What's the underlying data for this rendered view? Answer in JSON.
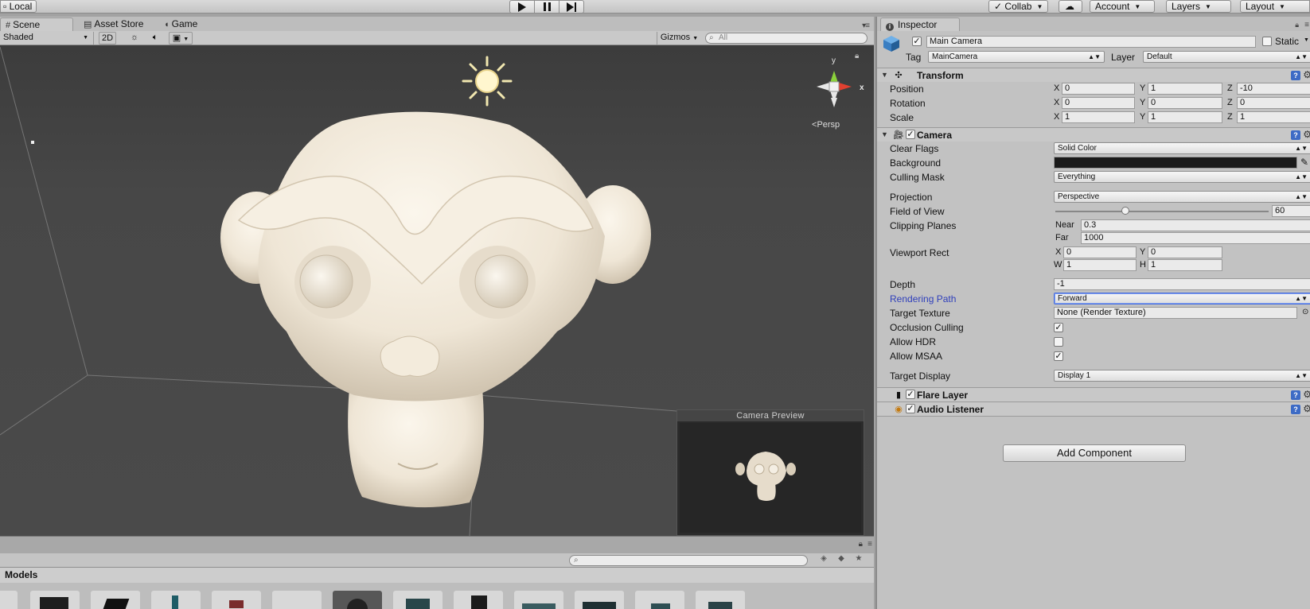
{
  "toolbar": {
    "local_label": "Local",
    "collab_label": "Collab",
    "account_label": "Account",
    "layers_label": "Layers",
    "layout_label": "Layout"
  },
  "scene_tabs": [
    {
      "label": "Scene",
      "icon": "grid-icon"
    },
    {
      "label": "Asset Store",
      "icon": "store-icon"
    },
    {
      "label": "Game",
      "icon": "pacman-icon"
    }
  ],
  "scene_controls": {
    "shading_mode": "Shaded",
    "mode_2d": "2D",
    "gizmos_label": "Gizmos",
    "search_placeholder": "All"
  },
  "scene_view": {
    "projection_label": "Persp",
    "axis_labels": {
      "x": "x",
      "y": "y"
    },
    "camera_preview_title": "Camera Preview",
    "background_color": "#474747",
    "model_color": "#efe6d6"
  },
  "project": {
    "breadcrumb": "Models",
    "thumb_count": 12
  },
  "inspector": {
    "tab_label": "Inspector",
    "object_name": "Main Camera",
    "static_label": "Static",
    "tag_label": "Tag",
    "tag_value": "MainCamera",
    "layer_label": "Layer",
    "layer_value": "Default",
    "transform": {
      "title": "Transform",
      "rows": [
        {
          "label": "Position",
          "x": "0",
          "y": "1",
          "z": "-10"
        },
        {
          "label": "Rotation",
          "x": "0",
          "y": "0",
          "z": "0"
        },
        {
          "label": "Scale",
          "x": "1",
          "y": "1",
          "z": "1"
        }
      ]
    },
    "camera": {
      "title": "Camera",
      "clear_flags_label": "Clear Flags",
      "clear_flags_value": "Solid Color",
      "background_label": "Background",
      "background_color": "#1a1a1a",
      "culling_mask_label": "Culling Mask",
      "culling_mask_value": "Everything",
      "projection_label": "Projection",
      "projection_value": "Perspective",
      "fov_label": "Field of View",
      "fov_value": "60",
      "fov_fraction": 0.33,
      "clipping_label": "Clipping Planes",
      "near_label": "Near",
      "near_value": "0.3",
      "far_label": "Far",
      "far_value": "1000",
      "viewport_label": "Viewport Rect",
      "viewport": {
        "x": "0",
        "y": "0",
        "w": "1",
        "h": "1"
      },
      "depth_label": "Depth",
      "depth_value": "-1",
      "rendering_path_label": "Rendering Path",
      "rendering_path_value": "Forward",
      "target_texture_label": "Target Texture",
      "target_texture_value": "None (Render Texture)",
      "occlusion_label": "Occlusion Culling",
      "occlusion_checked": true,
      "hdr_label": "Allow HDR",
      "hdr_checked": false,
      "msaa_label": "Allow MSAA",
      "msaa_checked": true,
      "target_display_label": "Target Display",
      "target_display_value": "Display 1"
    },
    "flare_layer_title": "Flare Layer",
    "audio_listener_title": "Audio Listener",
    "add_component_label": "Add Component"
  }
}
